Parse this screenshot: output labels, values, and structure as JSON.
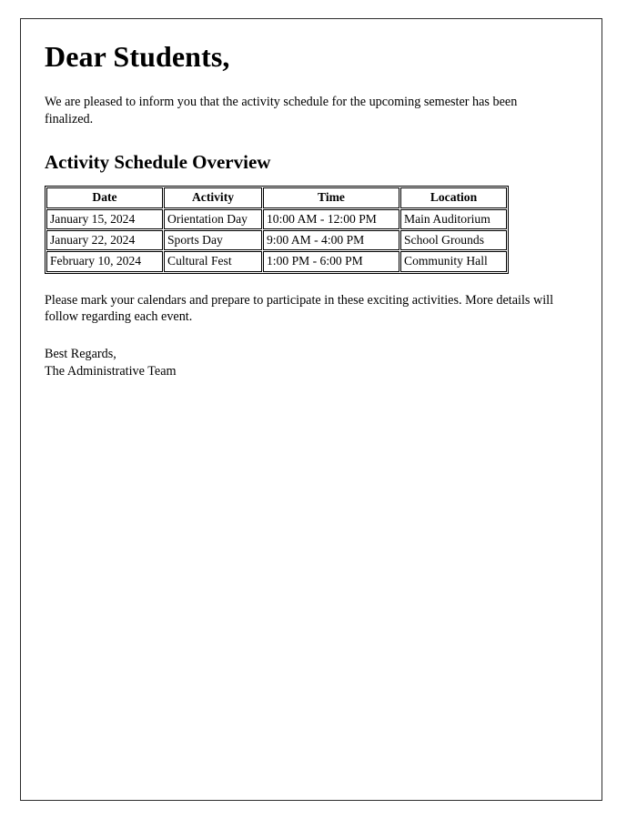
{
  "document": {
    "salutation": "Dear Students,",
    "intro_paragraph": "We are pleased to inform you that the activity schedule for the upcoming semester has been finalized.",
    "section_heading": "Activity Schedule Overview",
    "closing_paragraph": "Please mark your calendars and prepare to participate in these exciting activities. More details will follow regarding each event.",
    "signoff": {
      "line1": "Best Regards,",
      "line2": "The Administrative Team"
    }
  },
  "schedule_table": {
    "columns": [
      "Date",
      "Activity",
      "Time",
      "Location"
    ],
    "rows": [
      {
        "date": "January 15, 2024",
        "activity": "Orientation Day",
        "time": "10:00 AM - 12:00 PM",
        "location": "Main Auditorium"
      },
      {
        "date": "January 22, 2024",
        "activity": "Sports Day",
        "time": "9:00 AM - 4:00 PM",
        "location": "School Grounds"
      },
      {
        "date": "February 10, 2024",
        "activity": "Cultural Fest",
        "time": "1:00 PM - 6:00 PM",
        "location": "Community Hall"
      }
    ]
  },
  "style": {
    "text_color": "#000000",
    "page_border_color": "#2b2b2b",
    "page_background": "#ffffff"
  }
}
